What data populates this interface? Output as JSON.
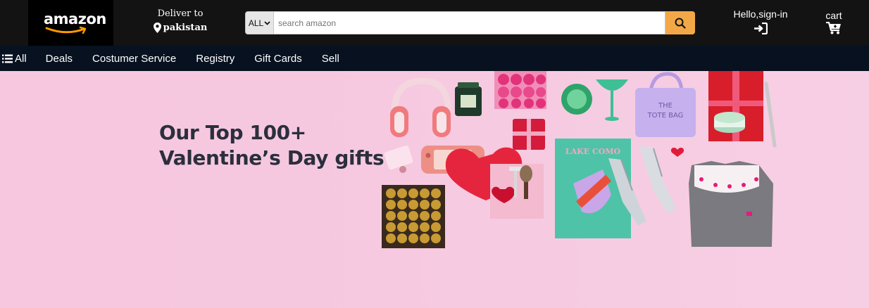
{
  "header": {
    "logo_text": "amazon",
    "deliver_to": "Deliver to",
    "location": "pakistan",
    "search": {
      "category": "ALL",
      "placeholder": "search amazon"
    },
    "account_label": "Hello,sign-in",
    "cart_label": "cart"
  },
  "nav": {
    "all_label": "All",
    "items": [
      "Deals",
      "Costumer Service",
      "Registry",
      "Gift Cards",
      "Sell"
    ]
  },
  "hero": {
    "title_line1": "Our Top 100+",
    "title_line2": "Valentine’s Day gifts",
    "book_title": "LAKE COMO",
    "bag_text_1": "THE",
    "bag_text_2": "TOTE BAG"
  },
  "icons": {
    "menu": "hamburger-icon",
    "location": "map-pin-icon",
    "search": "search-icon",
    "signin": "sign-in-icon",
    "cart": "cart-icon",
    "dropdown": "chevron-down-icon"
  },
  "colors": {
    "header_bg": "#131313",
    "nav_bg": "#07111f",
    "search_button": "#f3a847",
    "hero_bg": "#f7c6df",
    "hero_text": "#2b2f3c"
  }
}
